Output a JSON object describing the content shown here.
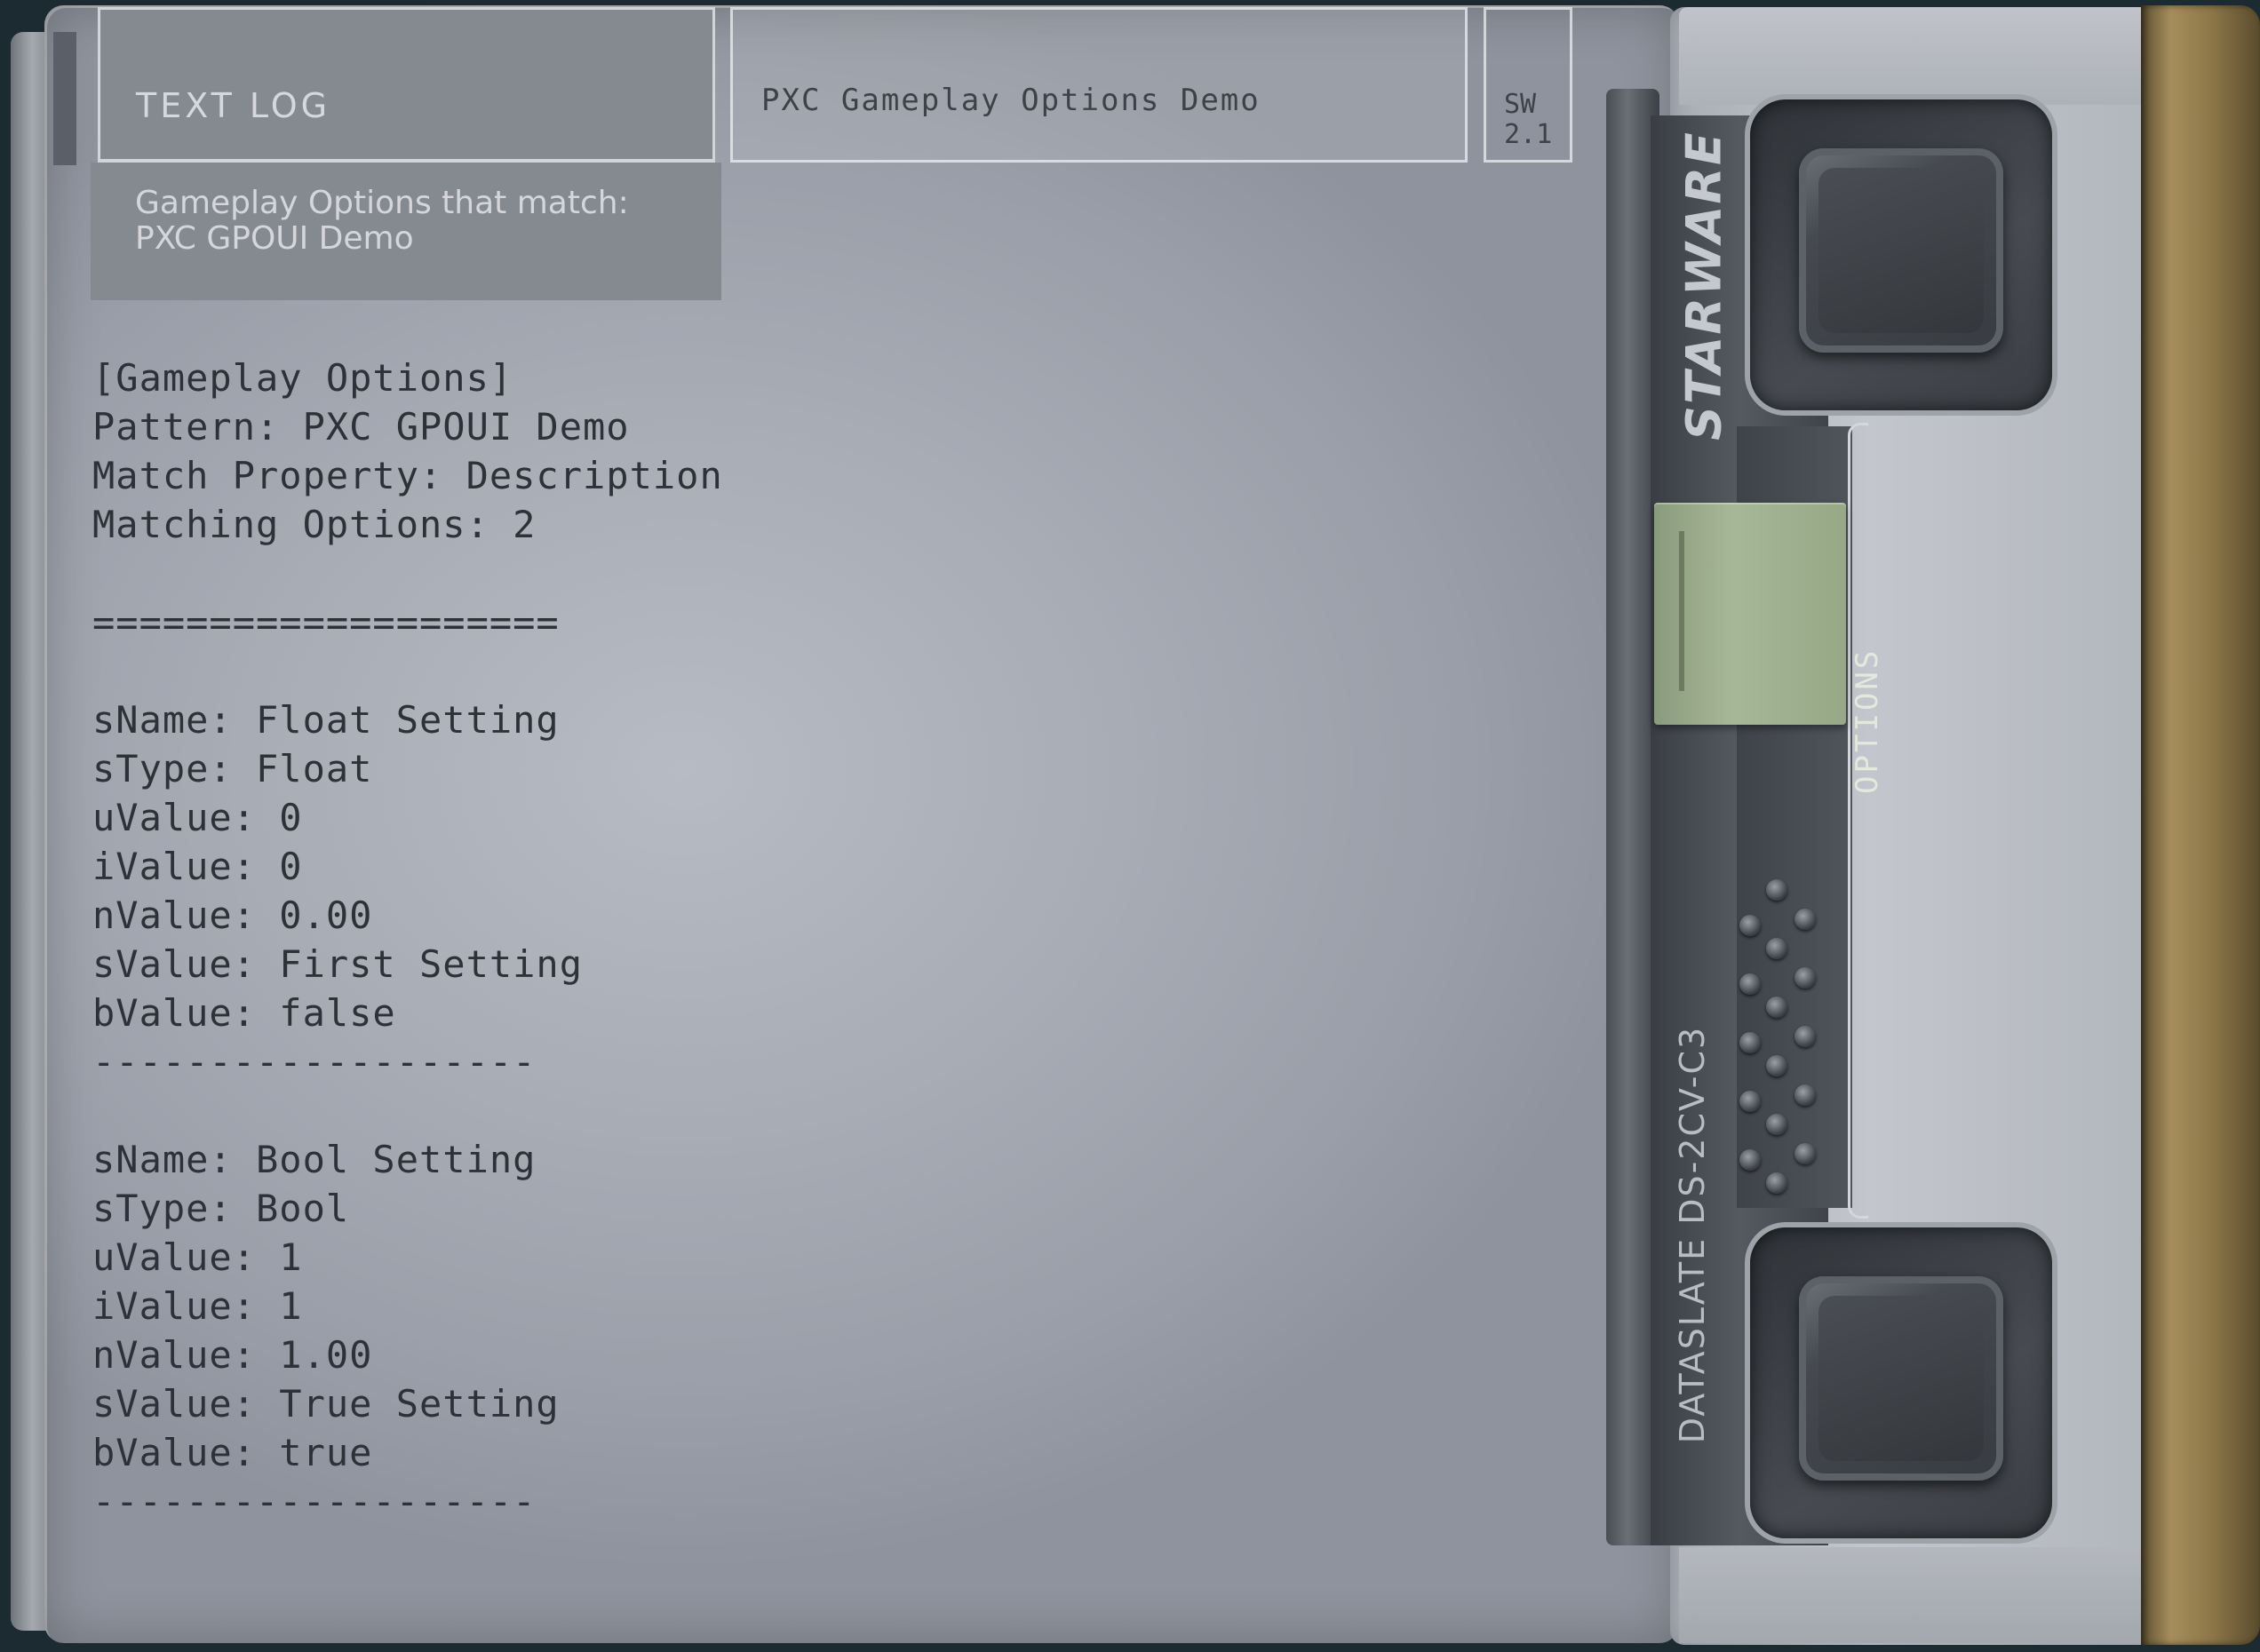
{
  "header": {
    "text_log_tab": "TEXT LOG",
    "text_log_subtitle": "Gameplay Options that match:\nPXC GPOUI Demo",
    "title": "PXC Gameplay Options Demo",
    "version": "SW\n2.1"
  },
  "log": {
    "section_header": "[Gameplay Options]",
    "pattern": "Pattern: PXC GPOUI Demo",
    "match_property": "Match Property: Description",
    "matching_options": "Matching Options: 2",
    "separator_major": "====================",
    "entries": [
      {
        "sName": "sName: Float Setting",
        "sType": "sType: Float",
        "uValue": "uValue: 0",
        "iValue": "iValue: 0",
        "nValue": "nValue: 0.00",
        "sValue": "sValue: First Setting",
        "bValue": "bValue: false",
        "separator": "-------------------"
      },
      {
        "sName": "sName: Bool Setting",
        "sType": "sType: Bool",
        "uValue": "uValue: 1",
        "iValue": "iValue: 1",
        "nValue": "nValue: 1.00",
        "sValue": "sValue: True Setting",
        "bValue": "bValue: true",
        "separator": "-------------------"
      }
    ]
  },
  "device": {
    "brand": "STARWARE",
    "model": "DATASLATE DS-2CV-C3",
    "options_button": "OPTIONS",
    "accent_color": "#a6b797",
    "brass_color": "#a68e5c"
  }
}
